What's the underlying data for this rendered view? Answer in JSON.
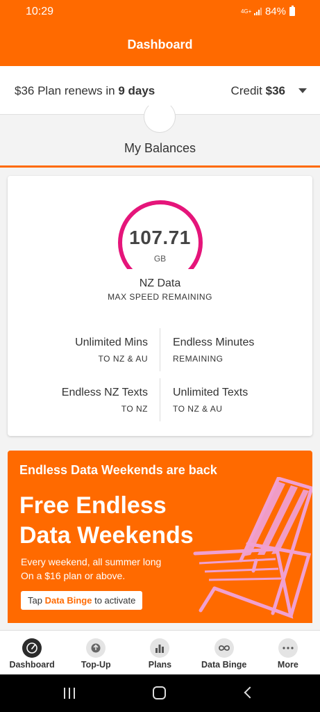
{
  "status_bar": {
    "time": "10:29",
    "network": "4G+",
    "battery": "84%"
  },
  "header": {
    "title": "Dashboard"
  },
  "plan": {
    "renew_prefix": "$36 Plan renews in ",
    "renew_days": "9 days",
    "credit_label": "Credit ",
    "credit_value": "$36"
  },
  "balances": {
    "title": "My Balances"
  },
  "data_card": {
    "gauge": {
      "value": "107.71",
      "unit": "GB",
      "arc_color": "#e5157a",
      "remaining_fraction": 1.0
    },
    "data_label": "NZ Data",
    "data_sub": "MAX SPEED REMAINING",
    "cells": [
      {
        "title": "Unlimited Mins",
        "sub": "TO NZ & AU"
      },
      {
        "title": "Endless Minutes",
        "sub": "REMAINING"
      },
      {
        "title": "Endless NZ Texts",
        "sub": "TO NZ"
      },
      {
        "title": "Unlimited Texts",
        "sub": "TO NZ & AU"
      }
    ]
  },
  "promo": {
    "kicker": "Endless Data Weekends are back",
    "headline_1": "Free Endless",
    "headline_2": "Data Weekends",
    "body_1": "Every weekend, all summer long",
    "body_2": "On a $16 plan or above.",
    "cta_prefix": "Tap ",
    "cta_bold": "Data Binge",
    "cta_suffix": " to activate",
    "accent": "#ff6a00",
    "chair_color": "#f0a0d0"
  },
  "bottom_nav": {
    "items": [
      {
        "label": "Dashboard",
        "icon": "speedometer-icon",
        "active": true
      },
      {
        "label": "Top-Up",
        "icon": "top-up-icon",
        "active": false
      },
      {
        "label": "Plans",
        "icon": "bar-chart-icon",
        "active": false
      },
      {
        "label": "Data Binge",
        "icon": "infinity-icon",
        "active": false
      },
      {
        "label": "More",
        "icon": "more-dots-icon",
        "active": false
      }
    ]
  },
  "colors": {
    "brand": "#ff6a00",
    "gauge": "#e5157a"
  }
}
